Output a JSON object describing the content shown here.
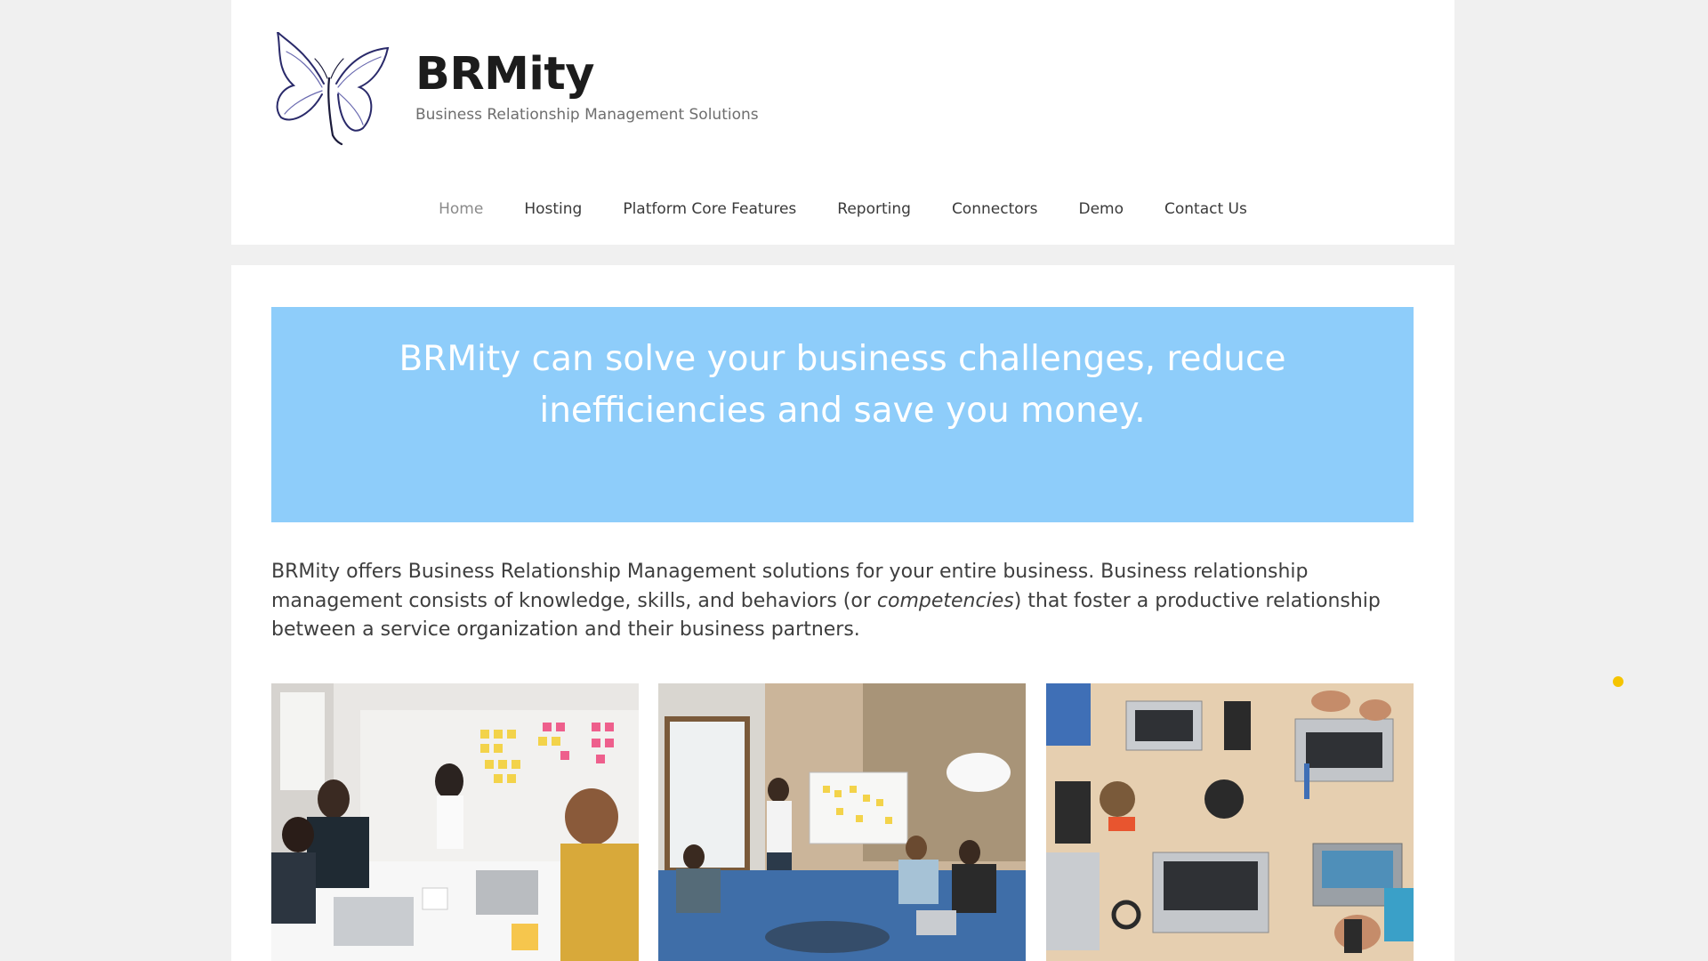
{
  "header": {
    "site_title": "BRMity",
    "tagline": "Business Relationship Management Solutions",
    "logo_icon": "butterfly-logo-icon"
  },
  "nav": {
    "items": [
      {
        "label": "Home",
        "active": true
      },
      {
        "label": "Hosting"
      },
      {
        "label": "Platform Core Features"
      },
      {
        "label": "Reporting"
      },
      {
        "label": "Connectors"
      },
      {
        "label": "Demo"
      },
      {
        "label": "Contact Us"
      }
    ]
  },
  "hero": {
    "headline": "BRMity can solve your business challenges, reduce inefficiencies and save you money.",
    "background_color": "#8ecdfa"
  },
  "intro": {
    "text_before": "BRMity offers Business Relationship Management solutions for your entire business. Business relationship management consists of knowledge, skills, and behaviors (or ",
    "emphasis": "competencies",
    "text_after": ") that foster a productive relationship between a service organization and their business partners."
  },
  "photos": [
    {
      "subject": "team-meeting-sticky-notes-photo"
    },
    {
      "subject": "office-presentation-whiteboard-photo"
    },
    {
      "subject": "laptops-on-table-overhead-photo"
    }
  ],
  "colors": {
    "page_background": "#f0f0f0",
    "accent_dot": "#f5c400"
  }
}
